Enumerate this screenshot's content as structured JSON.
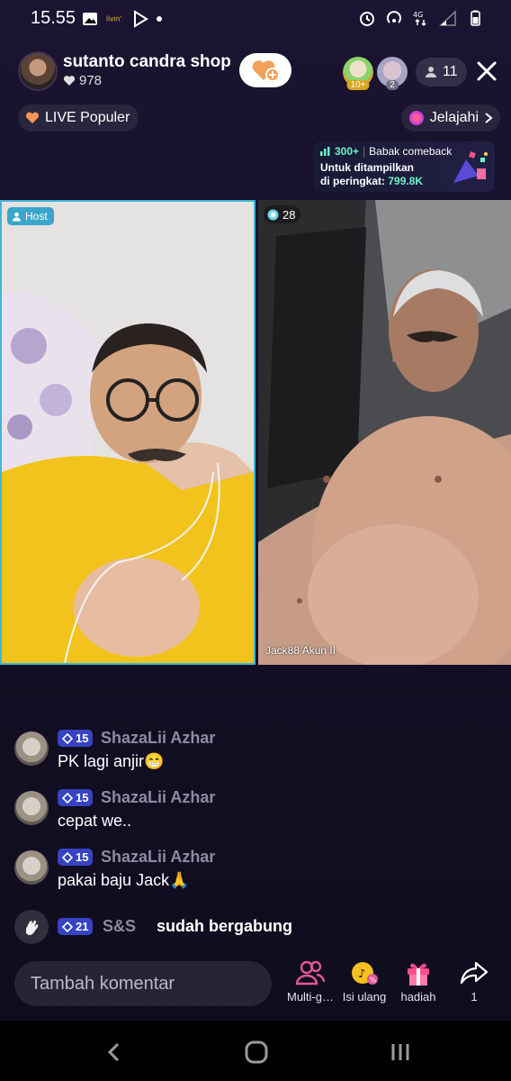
{
  "status_bar": {
    "time": "15.55",
    "network": "4G"
  },
  "header": {
    "host_name": "sutanto candra shop",
    "likes": "978",
    "viewer_badges": [
      "10+",
      "2"
    ],
    "viewer_count": "11"
  },
  "chips": {
    "live_label": "LIVE Populer",
    "explore_label": "Jelajahi"
  },
  "comeback": {
    "count": "300+",
    "title": "Babak comeback",
    "line1": "Untuk ditampilkan",
    "line2_prefix": "di peringkat:",
    "line2_value": "799.8K"
  },
  "tiles": {
    "host_label": "Host",
    "guest_score": "28",
    "guest_name": "Jack88 Akun II"
  },
  "chat": {
    "messages": [
      {
        "level": "15",
        "user": "ShazaLii Azhar",
        "text": "PK lagi anjir😁"
      },
      {
        "level": "15",
        "user": "ShazaLii Azhar",
        "text": "cepat we.."
      },
      {
        "level": "15",
        "user": "ShazaLii Azhar",
        "text": "pakai baju Jack🙏"
      }
    ],
    "join": {
      "level": "21",
      "user": "S&S",
      "text": "sudah bergabung"
    }
  },
  "bottom_bar": {
    "comment_placeholder": "Tambah komentar",
    "items": [
      {
        "label": "Multi-g…"
      },
      {
        "label": "Isi ulang"
      },
      {
        "label": "hadiah"
      },
      {
        "label": "1"
      }
    ]
  },
  "colors": {
    "accent_cyan": "#3fb6d9",
    "level_badge": "#3743c3",
    "highlight_green": "#6ef2c8",
    "icon_pink": "#e0579a"
  }
}
